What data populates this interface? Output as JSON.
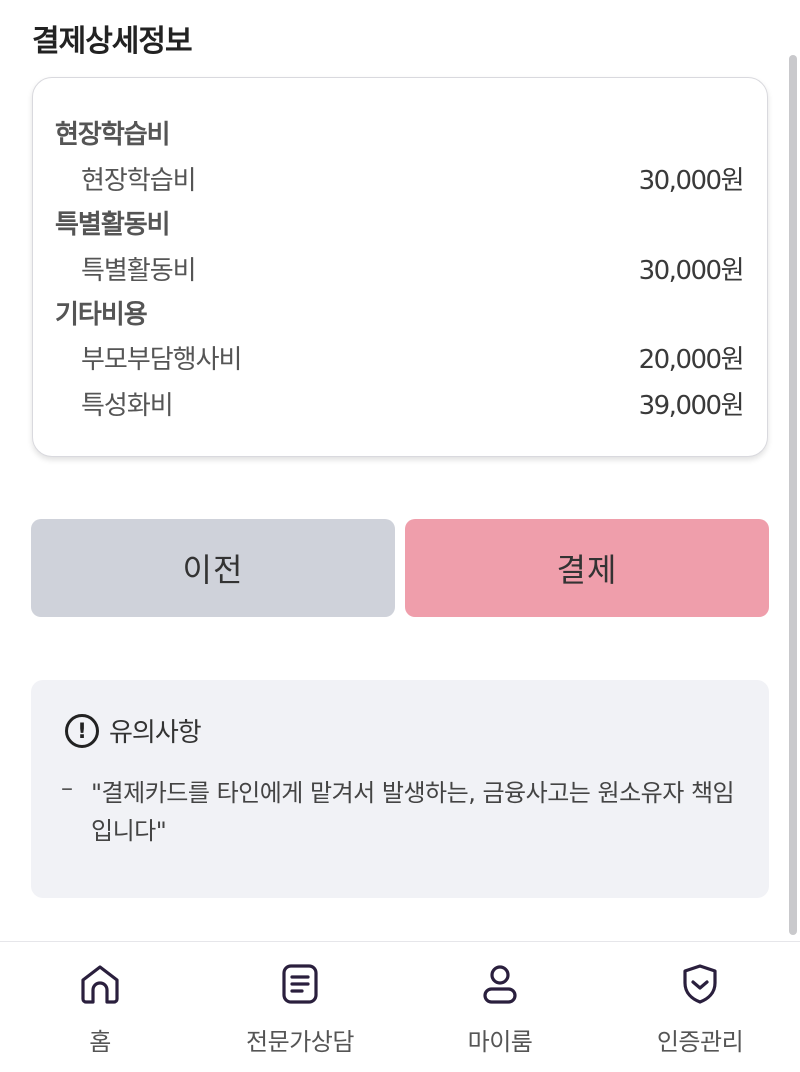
{
  "header": {
    "title": "결제상세정보"
  },
  "fees": {
    "groups": [
      {
        "title": "현장학습비",
        "items": [
          {
            "label": "현장학습비",
            "amount": "30,000원"
          }
        ]
      },
      {
        "title": "특별활동비",
        "items": [
          {
            "label": "특별활동비",
            "amount": "30,000원"
          }
        ]
      },
      {
        "title": "기타비용",
        "items": [
          {
            "label": "부모부담행사비",
            "amount": "20,000원"
          },
          {
            "label": "특성화비",
            "amount": "39,000원"
          }
        ]
      }
    ]
  },
  "buttons": {
    "prev_label": "이전",
    "pay_label": "결제"
  },
  "notice": {
    "icon_glyph": "!",
    "title": "유의사항",
    "dash": "–",
    "body": "\"결제카드를 타인에게 맡겨서 발생하는, 금융사고는 원소유자 책임입니다\""
  },
  "tabs": [
    {
      "label": "홈",
      "icon": "home-icon"
    },
    {
      "label": "전문가상담",
      "icon": "document-icon"
    },
    {
      "label": "마이룸",
      "icon": "user-icon"
    },
    {
      "label": "인증관리",
      "icon": "shield-check-icon"
    }
  ],
  "colors": {
    "prev_button": "#cfd2da",
    "pay_button": "#ef9eab",
    "notice_bg": "#f1f2f6",
    "icon_stroke": "#2a1f3d"
  }
}
